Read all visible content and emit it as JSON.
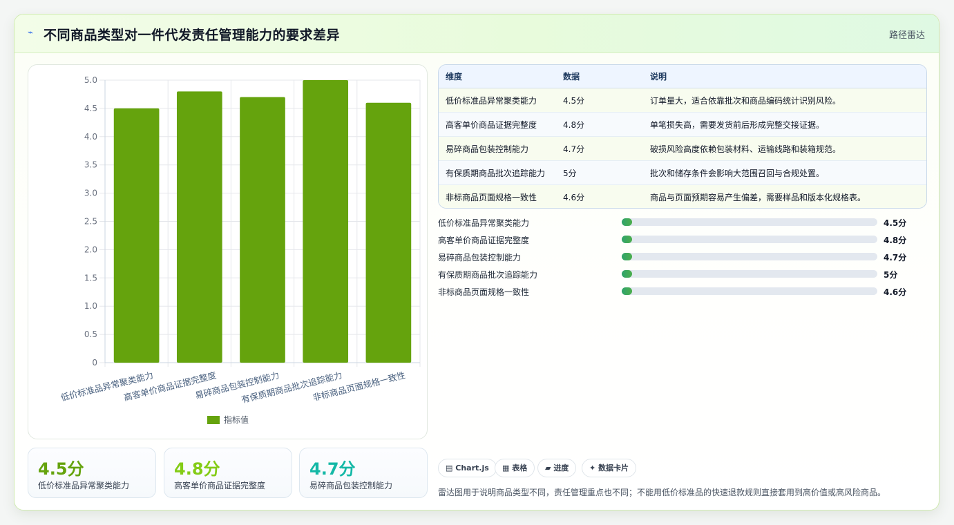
{
  "header": {
    "icon": "lightning-icon",
    "title": "不同商品类型对一件代发责任管理能力的要求差异",
    "tag": "路径雷达"
  },
  "chart_data": {
    "type": "bar",
    "categories": [
      "低价标准品异常聚类能力",
      "高客单价商品证据完整度",
      "易碎商品包装控制能力",
      "有保质期商品批次追踪能力",
      "非标商品页面规格一致性"
    ],
    "series": [
      {
        "name": "指标值",
        "values": [
          4.5,
          4.8,
          4.7,
          5.0,
          4.6
        ]
      }
    ],
    "yticks": [
      "0",
      "0.5",
      "1.0",
      "1.5",
      "2.0",
      "2.5",
      "3.0",
      "3.5",
      "4.0",
      "4.5",
      "5.0"
    ],
    "ylim": [
      0,
      5
    ],
    "grid": true,
    "legend": "bottom",
    "color": "#65a30d"
  },
  "table": {
    "headers": [
      "维度",
      "数据",
      "说明"
    ],
    "rows": [
      {
        "dim": "低价标准品异常聚类能力",
        "data": "4.5分",
        "desc": "订单量大，适合依靠批次和商品编码统计识别风险。"
      },
      {
        "dim": "高客单价商品证据完整度",
        "data": "4.8分",
        "desc": "单笔损失高，需要发货前后形成完整交接证据。"
      },
      {
        "dim": "易碎商品包装控制能力",
        "data": "4.7分",
        "desc": "破损风险高度依赖包装材料、运输线路和装箱规范。"
      },
      {
        "dim": "有保质期商品批次追踪能力",
        "data": "5分",
        "desc": "批次和储存条件会影响大范围召回与合规处置。"
      },
      {
        "dim": "非标商品页面规格一致性",
        "data": "4.6分",
        "desc": "商品与页面预期容易产生偏差，需要样品和版本化规格表。"
      }
    ]
  },
  "progress": [
    {
      "label": "低价标准品异常聚类能力",
      "value": "4.5分",
      "fraction": 0.04
    },
    {
      "label": "高客单价商品证据完整度",
      "value": "4.8分",
      "fraction": 0.04
    },
    {
      "label": "易碎商品包装控制能力",
      "value": "4.7分",
      "fraction": 0.04
    },
    {
      "label": "有保质期商品批次追踪能力",
      "value": "5分",
      "fraction": 0.04
    },
    {
      "label": "非标商品页面规格一致性",
      "value": "4.6分",
      "fraction": 0.04
    }
  ],
  "kpis": [
    {
      "value": "4.5分",
      "label": "低价标准品异常聚类能力",
      "color": "#65a30d"
    },
    {
      "value": "4.8分",
      "label": "高客单价商品证据完整度",
      "color": "#84cc16"
    },
    {
      "value": "4.7分",
      "label": "易碎商品包装控制能力",
      "color": "#14b8a6"
    }
  ],
  "chips": [
    {
      "icon": "chart-icon",
      "glyph": "▤",
      "label": "Chart.js"
    },
    {
      "icon": "table-icon",
      "glyph": "▦",
      "label": "表格"
    },
    {
      "icon": "progress-icon",
      "glyph": "▰",
      "label": "进度"
    },
    {
      "icon": "sparkle-icon",
      "glyph": "✦",
      "label": "数据卡片"
    }
  ],
  "note": "雷达图用于说明商品类型不同，责任管理重点也不同；不能用低价标准品的快速退款规则直接套用到高价值或高风险商品。"
}
